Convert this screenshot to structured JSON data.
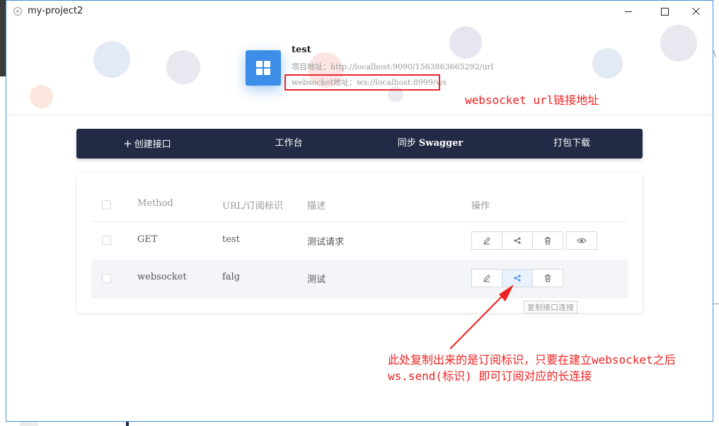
{
  "window": {
    "title": "my-project2"
  },
  "project": {
    "name": "test",
    "url_label": "项目地址：",
    "url": "http://localhost:9090/1563863665292/url",
    "ws_label": "websocket地址：",
    "ws_url": "ws://localhost:8999/ws"
  },
  "annotations": {
    "ws_note": "websocket url链接地址",
    "copy_note_line1": "此处复制出来的是订阅标识，只要在建立websocket之后",
    "copy_note_line2": "ws.send(标识) 即可订阅对应的长连接"
  },
  "toolbar": {
    "create_label": "创建接口",
    "workspace_label": "工作台",
    "sync_prefix": "同步 ",
    "sync_name": "Swagger",
    "download_label": "打包下载"
  },
  "table": {
    "headers": {
      "method": "Method",
      "url": "URL/订阅标识",
      "desc": "描述",
      "op": "操作"
    },
    "rows": [
      {
        "method": "GET",
        "url": "test",
        "desc": "测试请求"
      },
      {
        "method": "websocket",
        "url": "falg",
        "desc": "测试"
      }
    ]
  },
  "tooltip": {
    "text": "复制接口连接"
  },
  "icons": {
    "edit": "pencil-icon",
    "share": "share-icon",
    "delete": "trash-icon",
    "view": "eye-icon"
  },
  "colors": {
    "accent": "#3c8ee8",
    "toolbar_bg": "#222a45",
    "annotation": "#ee2222"
  },
  "right_edge_char": "\\"
}
